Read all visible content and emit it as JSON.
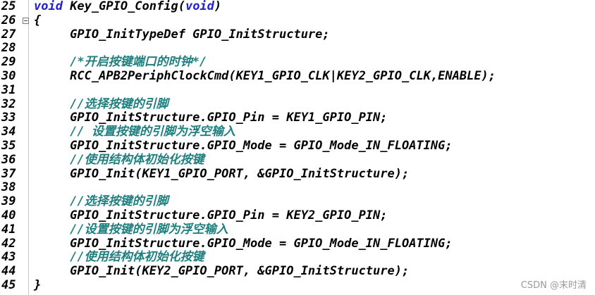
{
  "lines": [
    {
      "n": "25",
      "parts": [
        {
          "t": "void",
          "c": "kw"
        },
        {
          "t": " Key_GPIO_Config(",
          "c": ""
        },
        {
          "t": "void",
          "c": "kw"
        },
        {
          "t": ")",
          "c": ""
        }
      ],
      "fold": false
    },
    {
      "n": "26",
      "parts": [
        {
          "t": "{",
          "c": ""
        }
      ],
      "fold": true
    },
    {
      "n": "27",
      "parts": [
        {
          "t": "     GPIO_InitTypeDef GPIO_InitStructure;",
          "c": ""
        }
      ],
      "fold": false
    },
    {
      "n": "28",
      "parts": [],
      "fold": false
    },
    {
      "n": "29",
      "parts": [
        {
          "t": "     /*开启按键端口的时钟*/",
          "c": "cm"
        }
      ],
      "fold": false
    },
    {
      "n": "30",
      "parts": [
        {
          "t": "     RCC_APB2PeriphClockCmd(KEY1_GPIO_CLK|KEY2_GPIO_CLK,ENABLE);",
          "c": ""
        }
      ],
      "fold": false
    },
    {
      "n": "31",
      "parts": [],
      "fold": false
    },
    {
      "n": "32",
      "parts": [
        {
          "t": "     //选择按键的引脚",
          "c": "cm"
        }
      ],
      "fold": false
    },
    {
      "n": "33",
      "parts": [
        {
          "t": "     GPIO_InitStructure.GPIO_Pin = KEY1_GPIO_PIN;",
          "c": ""
        }
      ],
      "fold": false
    },
    {
      "n": "34",
      "parts": [
        {
          "t": "     // 设置按键的引脚为浮空输入",
          "c": "cm"
        }
      ],
      "fold": false
    },
    {
      "n": "35",
      "parts": [
        {
          "t": "     GPIO_InitStructure.GPIO_Mode = GPIO_Mode_IN_FLOATING;",
          "c": ""
        }
      ],
      "fold": false
    },
    {
      "n": "36",
      "parts": [
        {
          "t": "     //使用结构体初始化按键",
          "c": "cm"
        }
      ],
      "fold": false
    },
    {
      "n": "37",
      "parts": [
        {
          "t": "     GPIO_Init(KEY1_GPIO_PORT, &GPIO_InitStructure);",
          "c": ""
        }
      ],
      "fold": false
    },
    {
      "n": "38",
      "parts": [],
      "fold": false
    },
    {
      "n": "39",
      "parts": [
        {
          "t": "     //选择按键的引脚",
          "c": "cm"
        }
      ],
      "fold": false
    },
    {
      "n": "40",
      "parts": [
        {
          "t": "     GPIO_InitStructure.GPIO_Pin = KEY2_GPIO_PIN;",
          "c": ""
        }
      ],
      "fold": false
    },
    {
      "n": "41",
      "parts": [
        {
          "t": "     //设置按键的引脚为浮空输入",
          "c": "cm"
        }
      ],
      "fold": false
    },
    {
      "n": "42",
      "parts": [
        {
          "t": "     GPIO_InitStructure.GPIO_Mode = GPIO_Mode_IN_FLOATING;",
          "c": ""
        }
      ],
      "fold": false
    },
    {
      "n": "43",
      "parts": [
        {
          "t": "     //使用结构体初始化按键",
          "c": "cm"
        }
      ],
      "fold": false
    },
    {
      "n": "44",
      "parts": [
        {
          "t": "     GPIO_Init(KEY2_GPIO_PORT, &GPIO_InitStructure);",
          "c": ""
        }
      ],
      "fold": false
    },
    {
      "n": "45",
      "parts": [
        {
          "t": "}",
          "c": ""
        }
      ],
      "fold": false
    }
  ],
  "watermark": "CSDN @末时清",
  "colors": {
    "keyword": "#1f1fd6",
    "comment": "#1f7f7f",
    "text": "#000000"
  }
}
